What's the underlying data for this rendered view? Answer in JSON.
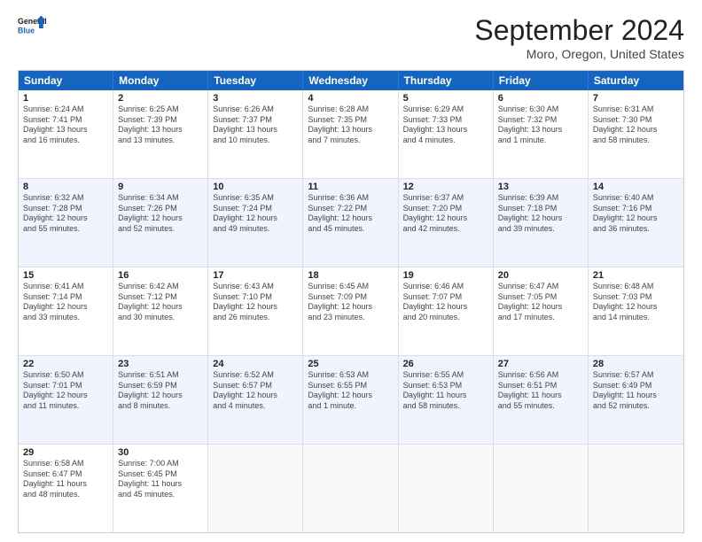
{
  "header": {
    "logo_line1": "General",
    "logo_line2": "Blue",
    "title": "September 2024",
    "subtitle": "Moro, Oregon, United States"
  },
  "days_of_week": [
    "Sunday",
    "Monday",
    "Tuesday",
    "Wednesday",
    "Thursday",
    "Friday",
    "Saturday"
  ],
  "weeks": [
    {
      "cells": [
        {
          "date": "1",
          "info": "Sunrise: 6:24 AM\nSunset: 7:41 PM\nDaylight: 13 hours\nand 16 minutes."
        },
        {
          "date": "2",
          "info": "Sunrise: 6:25 AM\nSunset: 7:39 PM\nDaylight: 13 hours\nand 13 minutes."
        },
        {
          "date": "3",
          "info": "Sunrise: 6:26 AM\nSunset: 7:37 PM\nDaylight: 13 hours\nand 10 minutes."
        },
        {
          "date": "4",
          "info": "Sunrise: 6:28 AM\nSunset: 7:35 PM\nDaylight: 13 hours\nand 7 minutes."
        },
        {
          "date": "5",
          "info": "Sunrise: 6:29 AM\nSunset: 7:33 PM\nDaylight: 13 hours\nand 4 minutes."
        },
        {
          "date": "6",
          "info": "Sunrise: 6:30 AM\nSunset: 7:32 PM\nDaylight: 13 hours\nand 1 minute."
        },
        {
          "date": "7",
          "info": "Sunrise: 6:31 AM\nSunset: 7:30 PM\nDaylight: 12 hours\nand 58 minutes."
        }
      ]
    },
    {
      "cells": [
        {
          "date": "8",
          "info": "Sunrise: 6:32 AM\nSunset: 7:28 PM\nDaylight: 12 hours\nand 55 minutes."
        },
        {
          "date": "9",
          "info": "Sunrise: 6:34 AM\nSunset: 7:26 PM\nDaylight: 12 hours\nand 52 minutes."
        },
        {
          "date": "10",
          "info": "Sunrise: 6:35 AM\nSunset: 7:24 PM\nDaylight: 12 hours\nand 49 minutes."
        },
        {
          "date": "11",
          "info": "Sunrise: 6:36 AM\nSunset: 7:22 PM\nDaylight: 12 hours\nand 45 minutes."
        },
        {
          "date": "12",
          "info": "Sunrise: 6:37 AM\nSunset: 7:20 PM\nDaylight: 12 hours\nand 42 minutes."
        },
        {
          "date": "13",
          "info": "Sunrise: 6:39 AM\nSunset: 7:18 PM\nDaylight: 12 hours\nand 39 minutes."
        },
        {
          "date": "14",
          "info": "Sunrise: 6:40 AM\nSunset: 7:16 PM\nDaylight: 12 hours\nand 36 minutes."
        }
      ]
    },
    {
      "cells": [
        {
          "date": "15",
          "info": "Sunrise: 6:41 AM\nSunset: 7:14 PM\nDaylight: 12 hours\nand 33 minutes."
        },
        {
          "date": "16",
          "info": "Sunrise: 6:42 AM\nSunset: 7:12 PM\nDaylight: 12 hours\nand 30 minutes."
        },
        {
          "date": "17",
          "info": "Sunrise: 6:43 AM\nSunset: 7:10 PM\nDaylight: 12 hours\nand 26 minutes."
        },
        {
          "date": "18",
          "info": "Sunrise: 6:45 AM\nSunset: 7:09 PM\nDaylight: 12 hours\nand 23 minutes."
        },
        {
          "date": "19",
          "info": "Sunrise: 6:46 AM\nSunset: 7:07 PM\nDaylight: 12 hours\nand 20 minutes."
        },
        {
          "date": "20",
          "info": "Sunrise: 6:47 AM\nSunset: 7:05 PM\nDaylight: 12 hours\nand 17 minutes."
        },
        {
          "date": "21",
          "info": "Sunrise: 6:48 AM\nSunset: 7:03 PM\nDaylight: 12 hours\nand 14 minutes."
        }
      ]
    },
    {
      "cells": [
        {
          "date": "22",
          "info": "Sunrise: 6:50 AM\nSunset: 7:01 PM\nDaylight: 12 hours\nand 11 minutes."
        },
        {
          "date": "23",
          "info": "Sunrise: 6:51 AM\nSunset: 6:59 PM\nDaylight: 12 hours\nand 8 minutes."
        },
        {
          "date": "24",
          "info": "Sunrise: 6:52 AM\nSunset: 6:57 PM\nDaylight: 12 hours\nand 4 minutes."
        },
        {
          "date": "25",
          "info": "Sunrise: 6:53 AM\nSunset: 6:55 PM\nDaylight: 12 hours\nand 1 minute."
        },
        {
          "date": "26",
          "info": "Sunrise: 6:55 AM\nSunset: 6:53 PM\nDaylight: 11 hours\nand 58 minutes."
        },
        {
          "date": "27",
          "info": "Sunrise: 6:56 AM\nSunset: 6:51 PM\nDaylight: 11 hours\nand 55 minutes."
        },
        {
          "date": "28",
          "info": "Sunrise: 6:57 AM\nSunset: 6:49 PM\nDaylight: 11 hours\nand 52 minutes."
        }
      ]
    },
    {
      "cells": [
        {
          "date": "29",
          "info": "Sunrise: 6:58 AM\nSunset: 6:47 PM\nDaylight: 11 hours\nand 48 minutes."
        },
        {
          "date": "30",
          "info": "Sunrise: 7:00 AM\nSunset: 6:45 PM\nDaylight: 11 hours\nand 45 minutes."
        },
        {
          "date": "",
          "info": ""
        },
        {
          "date": "",
          "info": ""
        },
        {
          "date": "",
          "info": ""
        },
        {
          "date": "",
          "info": ""
        },
        {
          "date": "",
          "info": ""
        }
      ]
    }
  ]
}
